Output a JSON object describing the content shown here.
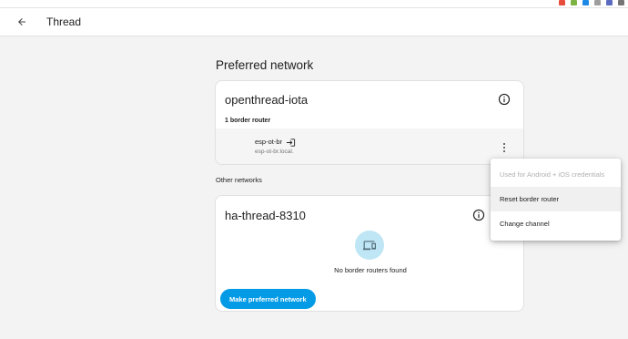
{
  "header": {
    "title": "Thread"
  },
  "preferred": {
    "section_title": "Preferred network",
    "network_name": "openthread-iota",
    "router_count": "1 border router",
    "router": {
      "name": "esp-ot-br",
      "host": "esp-ot-br.local."
    }
  },
  "other": {
    "section_title": "Other networks",
    "network_name": "ha-thread-8310",
    "empty_text": "No border routers found",
    "make_preferred_label": "Make preferred network"
  },
  "menu": {
    "items": [
      {
        "label": "Used for Android + iOS credentials",
        "disabled": true
      },
      {
        "label": "Reset border router",
        "disabled": false
      },
      {
        "label": "Change channel",
        "disabled": false
      }
    ]
  },
  "colors": {
    "accent": "#039be5",
    "empty_icon_bg": "#bfe6f5",
    "page_bg": "#f3f3f3"
  },
  "icons": [
    "back-arrow-icon",
    "info-icon",
    "login-icon",
    "more-vert-icon",
    "devices-icon"
  ]
}
